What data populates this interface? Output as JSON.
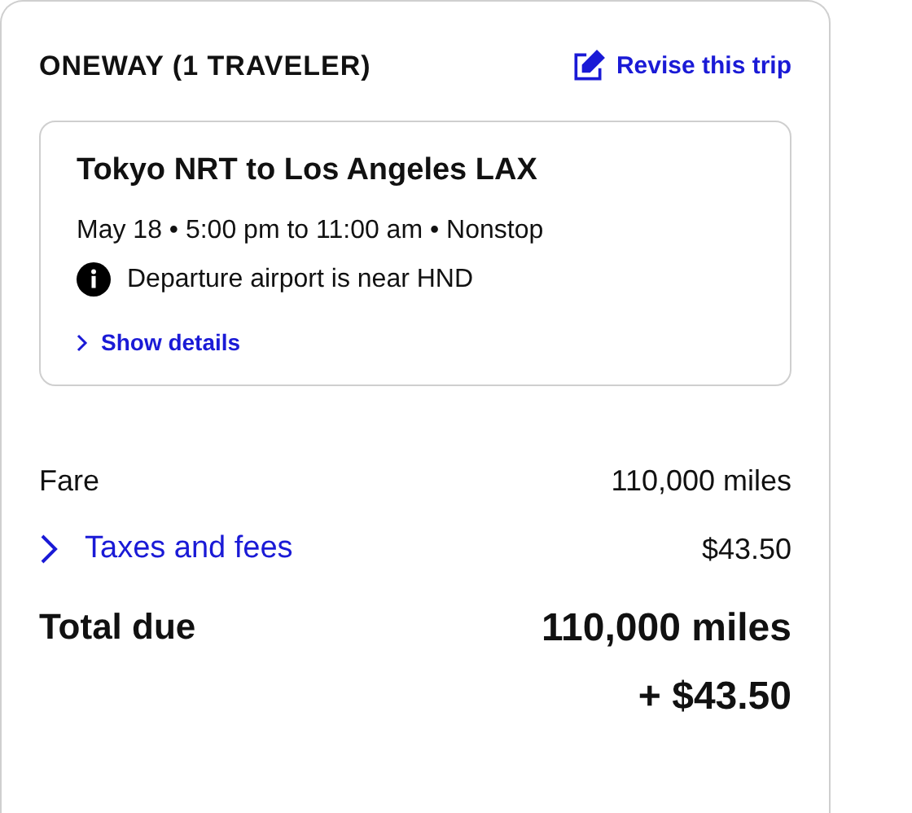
{
  "header": {
    "title": "ONEWAY (1 TRAVELER)",
    "action": "Revise this trip"
  },
  "flight": {
    "route": "Tokyo NRT to Los Angeles LAX",
    "schedule": "May 18 • 5:00 pm to 11:00 am • Nonstop",
    "notice": "Departure airport is near HND",
    "details_link": "Show details"
  },
  "price_rows": [
    {
      "label": "Fare",
      "value": "110,000 miles",
      "kind": "plain"
    },
    {
      "label": "Taxes and fees",
      "value": "$43.50",
      "kind": "expandable"
    }
  ],
  "total": {
    "label": "Total due",
    "lines": [
      "110,000 miles",
      "+ $43.50"
    ]
  }
}
